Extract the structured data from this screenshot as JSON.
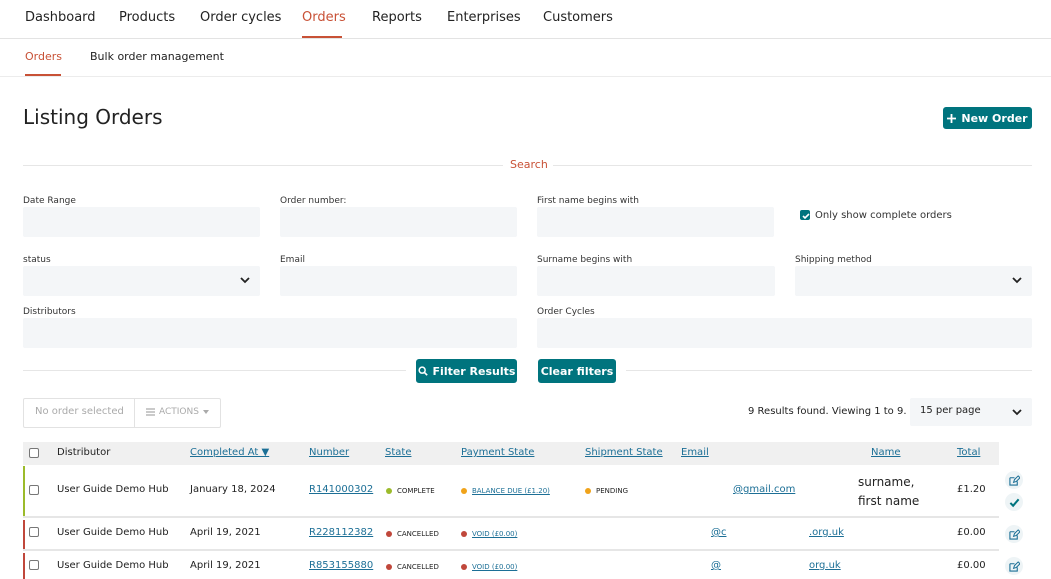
{
  "colors": {
    "accent": "#c85136",
    "teal": "#00747e",
    "link": "#1c6f96",
    "complete_dot": "#9cbb2b",
    "pending_dot": "#f0a31a",
    "cancelled_dot": "#c0473b"
  },
  "topnav": {
    "items": [
      "Dashboard",
      "Products",
      "Order cycles",
      "Orders",
      "Reports",
      "Enterprises",
      "Customers"
    ],
    "active": "Orders"
  },
  "subnav": {
    "items": [
      "Orders",
      "Bulk order management"
    ],
    "active": "Orders"
  },
  "page": {
    "title": "Listing Orders",
    "new_order_label": "New Order"
  },
  "search": {
    "label": "Search",
    "date_range": "Date Range",
    "order_number": "Order number:",
    "first_name": "First name begins with",
    "only_complete": "Only show complete orders",
    "status": "status",
    "email": "Email",
    "surname": "Surname begins with",
    "shipping_method": "Shipping method",
    "distributors": "Distributors",
    "order_cycles": "Order Cycles",
    "filter_button": "Filter Results",
    "clear_button": "Clear filters"
  },
  "toolbar": {
    "no_order_selected": "No order selected",
    "actions": "ACTIONS",
    "results": "9 Results found. Viewing 1 to 9.",
    "per_page": "15 per page"
  },
  "table": {
    "headers": [
      "Distributor",
      "Completed At ▼",
      "Number",
      "State",
      "Payment State",
      "Shipment State",
      "Email",
      "Name",
      "Total"
    ],
    "rows": [
      {
        "distributor": "User Guide Demo Hub",
        "completed_at": "January 18, 2024",
        "number": "R141000302",
        "state": "COMPLETE",
        "payment_state": "BALANCE DUE (£1.20)",
        "shipment_state": "PENDING",
        "email": "@gmail.com",
        "email_extra": "",
        "name_line1": "surname,",
        "name_line2": "first name",
        "total": "£1.20"
      },
      {
        "distributor": "User Guide Demo Hub",
        "completed_at": "April 19, 2021",
        "number": "R228112382",
        "state": "CANCELLED",
        "payment_state": "VOID (£0.00)",
        "shipment_state": "",
        "email": "@c",
        "email_extra": ".org.uk",
        "name_line1": "",
        "name_line2": "",
        "total": "£0.00"
      },
      {
        "distributor": "User Guide Demo Hub",
        "completed_at": "April 19, 2021",
        "number": "R853155880",
        "state": "CANCELLED",
        "payment_state": "VOID (£0.00)",
        "shipment_state": "",
        "email": "@",
        "email_extra": "org.uk",
        "name_line1": "",
        "name_line2": "",
        "total": "£0.00"
      }
    ]
  },
  "icons": [
    "plus-icon",
    "search-icon",
    "chevron-down-icon",
    "hamburger-icon",
    "edit-icon",
    "check-icon"
  ]
}
